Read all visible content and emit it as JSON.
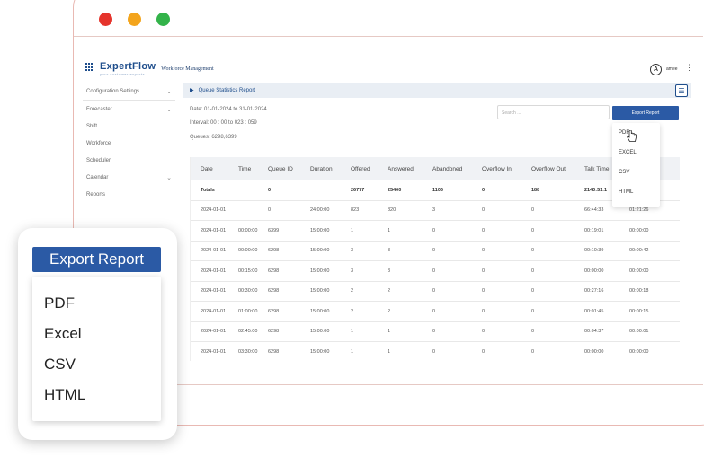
{
  "app": {
    "logo_title": "ExpertFlow",
    "logo_tagline": "your customer experts",
    "app_name": "Workforce Management",
    "avatar_letter": "A",
    "username": "amee"
  },
  "sidebar": {
    "items": [
      {
        "label": "Configuration Settings",
        "expandable": true
      },
      {
        "label": "Forecaster",
        "expandable": true
      },
      {
        "label": "Shift",
        "expandable": false
      },
      {
        "label": "Workforce",
        "expandable": false
      },
      {
        "label": "Scheduler",
        "expandable": false
      },
      {
        "label": "Calendar",
        "expandable": true
      },
      {
        "label": "Reports",
        "expandable": false
      }
    ]
  },
  "report": {
    "title": "Queue Statistics Report",
    "date_text": "Date:  01-01-2024 to 31-01-2024",
    "interval_text": "Interval:  00 : 00 to 023 : 059",
    "queues_text": "Queues:  6298,6399",
    "search_placeholder": "Search ...",
    "export_label": "Export Report",
    "export_options": [
      "PDF",
      "EXCEL",
      "CSV",
      "HTML"
    ]
  },
  "table": {
    "headers": [
      "Date",
      "Time",
      "Queue ID",
      "Duration",
      "Offered",
      "Answered",
      "Abandoned",
      "Overflow In",
      "Overflow Out",
      "Talk Time",
      ""
    ],
    "rows": [
      [
        "Totals",
        "",
        "0",
        "",
        "26777",
        "25400",
        "1106",
        "0",
        "188",
        "2140:51:1",
        ""
      ],
      [
        "2024-01-01",
        "",
        "0",
        "24:00:00",
        "823",
        "820",
        "3",
        "0",
        "0",
        "66:44:33",
        "01:21:26"
      ],
      [
        "2024-01-01",
        "00:00:00",
        "6399",
        "15:00:00",
        "1",
        "1",
        "0",
        "0",
        "0",
        "00:19:01",
        "00:00:00"
      ],
      [
        "2024-01-01",
        "00:00:00",
        "6298",
        "15:00:00",
        "3",
        "3",
        "0",
        "0",
        "0",
        "00:10:39",
        "00:00:42"
      ],
      [
        "2024-01-01",
        "00:15:00",
        "6298",
        "15:00:00",
        "3",
        "3",
        "0",
        "0",
        "0",
        "00:00:00",
        "00:00:00"
      ],
      [
        "2024-01-01",
        "00:30:00",
        "6298",
        "15:00:00",
        "2",
        "2",
        "0",
        "0",
        "0",
        "00:27:16",
        "00:00:18"
      ],
      [
        "2024-01-01",
        "01:00:00",
        "6298",
        "15:00:00",
        "2",
        "2",
        "0",
        "0",
        "0",
        "00:01:45",
        "00:00:15"
      ],
      [
        "2024-01-01",
        "02:45:00",
        "6298",
        "15:00:00",
        "1",
        "1",
        "0",
        "0",
        "0",
        "00:04:37",
        "00:00:01"
      ],
      [
        "2024-01-01",
        "03:30:00",
        "6298",
        "15:00:00",
        "1",
        "1",
        "0",
        "0",
        "0",
        "00:00:00",
        "00:00:00"
      ]
    ]
  },
  "callout": {
    "export_label": "Export Report",
    "options": [
      "PDF",
      "Excel",
      "CSV",
      "HTML"
    ]
  },
  "colors": {
    "brand_blue": "#2b5aa5",
    "title_bar": "#e9eef4",
    "traffic_red": "#e5342c",
    "traffic_yellow": "#f3a41c",
    "traffic_green": "#33b34a"
  }
}
